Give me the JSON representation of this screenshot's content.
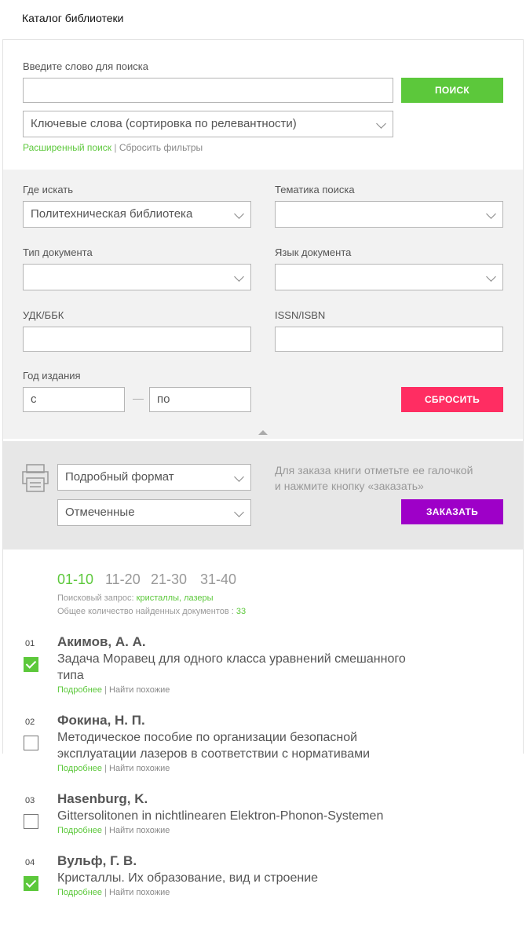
{
  "page_title": "Каталог библиотеки",
  "search": {
    "label": "Введите слово для поиска",
    "value": "",
    "button": "ПОИСК",
    "sort_select": "Ключевые слова (сортировка по релевантности)",
    "advanced_link": "Расширенный поиск",
    "separator": "|",
    "reset_filters_link": "Сбросить фильтры"
  },
  "filters": {
    "where_label": "Где искать",
    "where_value": "Политехническая библиотека",
    "topic_label": "Тематика поиска",
    "topic_value": "",
    "doc_type_label": "Тип документа",
    "doc_type_value": "",
    "lang_label": "Язык документа",
    "lang_value": "",
    "udk_label": "УДК/ББК",
    "udk_value": "",
    "issn_label": "ISSN/ISBN",
    "issn_value": "",
    "year_label": "Год издания",
    "year_from": "с",
    "year_dash": "—",
    "year_to": "по",
    "reset_button": "СБРОСИТЬ"
  },
  "order": {
    "printer_icon": "printer-icon",
    "format_select": "Подробный формат",
    "marked_select": "Отмеченные",
    "hint_line1": "Для заказа книги отметьте ее галочкой",
    "hint_line2": "и нажмите кнопку «заказать»",
    "order_button": "ЗАКАЗАТЬ"
  },
  "pager": {
    "pages": [
      "01-10",
      "11-20",
      "21-30",
      "31-40"
    ],
    "active": 0
  },
  "query_info": {
    "query_label": "Поисковый запрос: ",
    "query_value": "кристаллы, лазеры",
    "total_label": "Общее количество найденных документов : ",
    "total_value": "33"
  },
  "results": [
    {
      "num": "01",
      "author": "Акимов, А. А.",
      "title_lines": [
        "Задача Моравец для одного класса уравнений смешанного",
        "типа"
      ],
      "checked": true,
      "more": "Подробнее",
      "sep": " | ",
      "similar": "Найти похожие"
    },
    {
      "num": "02",
      "author": "Фокина, Н. П.",
      "title_lines": [
        "Методическое пособие по организации безопасной",
        "эксплуатации лазеров в соответствии с нормативами"
      ],
      "checked": false,
      "more": "Подробнее",
      "sep": " | ",
      "similar": "Найти похожие"
    },
    {
      "num": "03",
      "author": "Hasenburg, K.",
      "title_lines": [
        "Gittersolitonen in nichtlinearen Elektron-Phonon-Systemen"
      ],
      "checked": false,
      "more": "Подробнее",
      "sep": " | ",
      "similar": "Найти похожие"
    },
    {
      "num": "04",
      "author": "Вульф, Г. В.",
      "title_lines": [
        "Кристаллы. Их образование, вид и строение"
      ],
      "checked": true,
      "more": "Подробнее",
      "sep": " | ",
      "similar": "Найти похожие"
    }
  ],
  "colors": {
    "green": "#5cc83b",
    "pink": "#ff2d62",
    "purple": "#9e00c8"
  }
}
